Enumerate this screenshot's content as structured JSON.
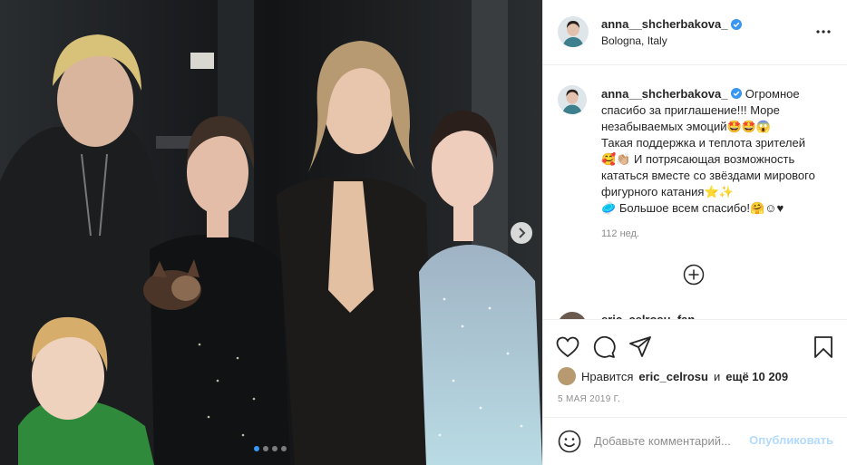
{
  "post": {
    "username": "anna__shcherbakova_",
    "location": "Bologna, Italy",
    "verified_icon": "verified-badge-icon"
  },
  "caption": {
    "username": "anna__shcherbakova_",
    "line1": "Огромное спасибо за приглашение!!! Море незабываемых эмоций",
    "emoji1": "🤩🤩😱",
    "line2": "Такая поддержка и теплота зрителей",
    "emoji2": "🥰👏🏼",
    "line3": "И потрясающая возможность кататься вместе со звёздами мирового фигурного катания",
    "emoji3": "⭐✨",
    "emoji4": "🥏",
    "line4": "Большое всем спасибо!",
    "emoji5": "🤗☺♥",
    "time": "112 нед."
  },
  "peek_comment": {
    "username": "eric_celrosu_fan"
  },
  "likes": {
    "prefix": "Нравится",
    "user": "eric_celrosu",
    "conj": "и",
    "count": "ещё 10 209"
  },
  "date": "5 мая 2019 г.",
  "comment": {
    "placeholder": "Добавьте комментарий...",
    "post_label": "Опубликовать"
  },
  "carousel": {
    "current": 1,
    "total": 4
  },
  "colors": {
    "accent": "#3897f0",
    "verified": "#3897f0",
    "muted": "#8e8e8e",
    "post_disabled": "#b3dbff"
  }
}
